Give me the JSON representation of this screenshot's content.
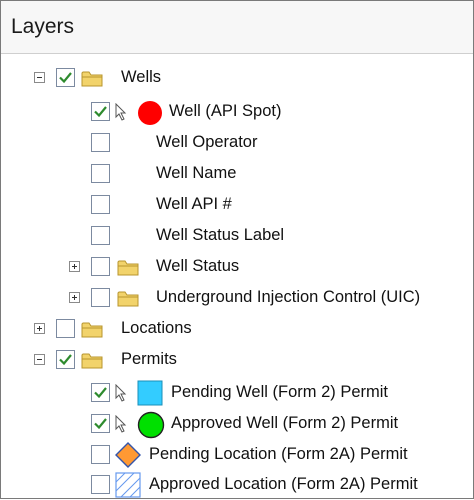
{
  "panel": {
    "title": "Layers"
  },
  "layers": {
    "wells": {
      "label": "Wells",
      "checked": true,
      "expanded": true
    },
    "well_api_spot": {
      "label": "Well (API Spot)",
      "checked": true,
      "symbol": "red-circle"
    },
    "well_operator": {
      "label": "Well Operator",
      "checked": false
    },
    "well_name": {
      "label": "Well Name",
      "checked": false
    },
    "well_api_num": {
      "label": "Well API #",
      "checked": false
    },
    "well_status_label": {
      "label": "Well Status Label",
      "checked": false
    },
    "well_status": {
      "label": "Well Status",
      "checked": false,
      "expanded": false
    },
    "uic": {
      "label": "Underground Injection Control (UIC)",
      "checked": false,
      "expanded": false
    },
    "locations": {
      "label": "Locations",
      "checked": false,
      "expanded": false
    },
    "permits": {
      "label": "Permits",
      "checked": true,
      "expanded": true
    },
    "pending_well": {
      "label": "Pending Well (Form 2) Permit",
      "checked": true,
      "symbol": "cyan-square"
    },
    "approved_well": {
      "label": "Approved Well (Form 2) Permit",
      "checked": true,
      "symbol": "green-circle"
    },
    "pending_location": {
      "label": "Pending Location (Form 2A) Permit",
      "checked": false,
      "symbol": "orange-diamond"
    },
    "approved_location": {
      "label": "Approved Location (Form 2A) Permit",
      "checked": false,
      "symbol": "hatched-blue-square"
    }
  },
  "colors": {
    "check_green": "#2e8b2e",
    "folder_fill": "#f2d36b",
    "folder_stroke": "#b8962e",
    "red_symbol": "#ff0000",
    "cyan_symbol": "#33ccff",
    "green_symbol": "#00e000",
    "orange_symbol": "#ff9933",
    "hatch_blue": "#6699ee"
  }
}
